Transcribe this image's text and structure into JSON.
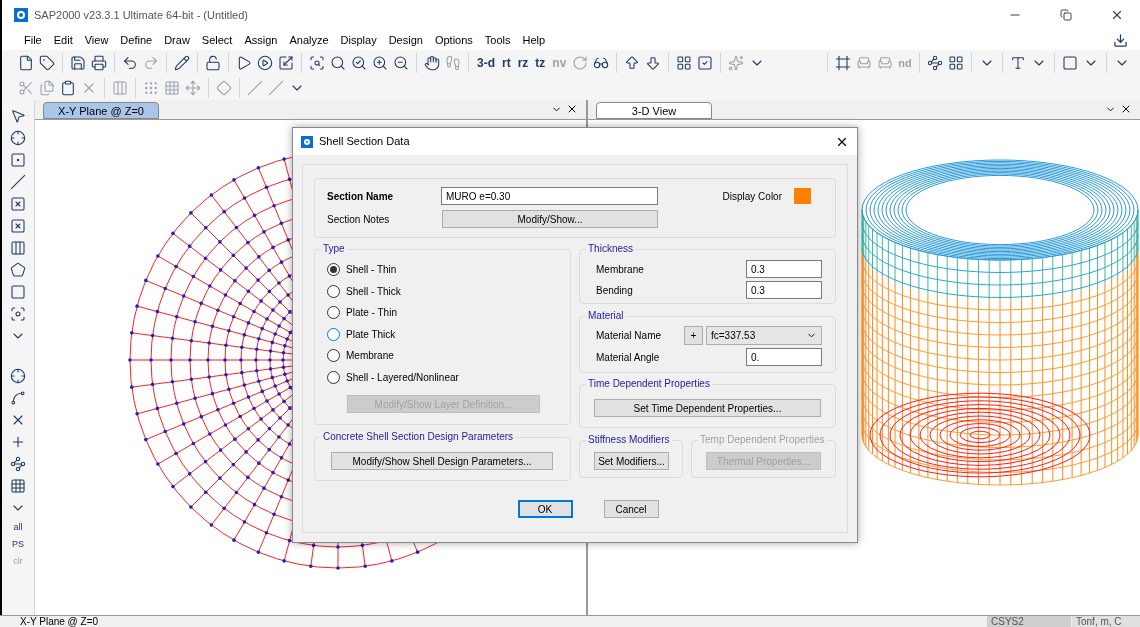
{
  "window": {
    "title": "SAP2000 v23.3.1 Ultimate 64-bit - (Untitled)"
  },
  "menu": [
    "File",
    "Edit",
    "View",
    "Define",
    "Draw",
    "Select",
    "Assign",
    "Analyze",
    "Display",
    "Design",
    "Options",
    "Tools",
    "Help"
  ],
  "toolbar": {
    "view_buttons": [
      {
        "label": "3-d",
        "disabled": false
      },
      {
        "label": "rt",
        "disabled": false
      },
      {
        "label": "rz",
        "disabled": false
      },
      {
        "label": "tz",
        "disabled": false
      },
      {
        "label": "nv",
        "disabled": true
      }
    ],
    "snap_buttons": [
      {
        "label": "nd",
        "disabled": true
      }
    ]
  },
  "side_toolbar": {
    "select_buttons": [
      {
        "label": "all",
        "disabled": false
      },
      {
        "label": "PS",
        "disabled": false
      },
      {
        "label": "clr",
        "disabled": true
      }
    ]
  },
  "panes": [
    {
      "tab": "X-Y Plane @ Z=0",
      "selected": true,
      "kind": "plan"
    },
    {
      "tab": "3-D View",
      "selected": false,
      "kind": "perspective"
    }
  ],
  "dialog": {
    "title": "Shell Section Data",
    "section_name": {
      "label": "Section Name",
      "value": "MURO e=0.30"
    },
    "section_notes": {
      "label": "Section Notes",
      "button": "Modify/Show..."
    },
    "display_color": {
      "label": "Display Color",
      "color": "#ff8000"
    },
    "type": {
      "title": "Type",
      "options": [
        {
          "label": "Shell - Thin",
          "selected": true,
          "hover": false
        },
        {
          "label": "Shell - Thick",
          "selected": false,
          "hover": false
        },
        {
          "label": "Plate - Thin",
          "selected": false,
          "hover": false
        },
        {
          "label": "Plate Thick",
          "selected": false,
          "hover": true
        },
        {
          "label": "Membrane",
          "selected": false,
          "hover": false
        },
        {
          "label": "Shell - Layered/Nonlinear",
          "selected": false,
          "hover": false
        }
      ],
      "button": {
        "label": "Modify/Show Layer Definition...",
        "disabled": true
      }
    },
    "concrete": {
      "title": "Concrete Shell Section Design Parameters",
      "button": "Modify/Show Shell Design Parameters..."
    },
    "thickness": {
      "title": "Thickness",
      "fields": [
        {
          "label": "Membrane",
          "value": "0.3"
        },
        {
          "label": "Bending",
          "value": "0.3"
        }
      ]
    },
    "material": {
      "title": "Material",
      "name_label": "Material Name",
      "add_button": "+",
      "material": "fc=337.53",
      "angle_label": "Material Angle",
      "angle": "0."
    },
    "time_dependent": {
      "title": "Time Dependent Properties",
      "button": "Set Time Dependent Properties..."
    },
    "stiffness": {
      "title": "Stiffness Modifiers",
      "button": "Set Modifiers...",
      "disabled": false
    },
    "temp_dependent": {
      "title": "Temp Dependent Properties",
      "button": "Thermal Properties...",
      "disabled": true
    },
    "buttons": [
      {
        "label": "OK",
        "default": true
      },
      {
        "label": "Cancel",
        "default": false
      }
    ]
  },
  "status_bar": {
    "view": "X-Y Plane @ Z=0",
    "coordinate_system": "CSYS2",
    "units": "Tonf, m, C"
  }
}
